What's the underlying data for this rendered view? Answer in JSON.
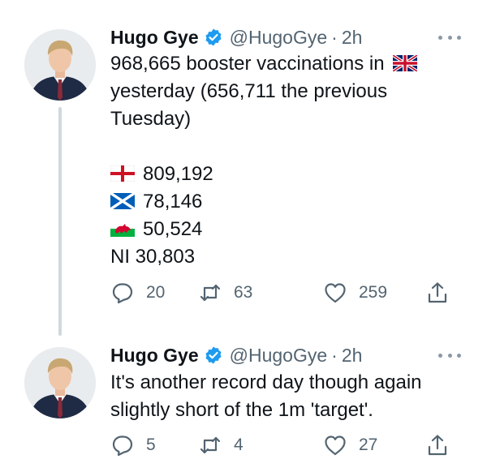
{
  "tweets": [
    {
      "author": {
        "name": "Hugo Gye",
        "handle": "@HugoGye",
        "separator": "·",
        "time": "2h"
      },
      "text": {
        "line1": "968,665 booster vaccinations in",
        "line1_flag": "uk-flag",
        "line2": "yesterday (656,711 the previous",
        "line3": "Tuesday)",
        "stats": [
          {
            "flag": "england-flag",
            "value": "809,192"
          },
          {
            "flag": "scotland-flag",
            "value": "78,146"
          },
          {
            "flag": "wales-flag",
            "value": "50,524"
          },
          {
            "flag": "",
            "value": "NI 30,803"
          }
        ]
      },
      "actions": {
        "replies": "20",
        "retweets": "63",
        "likes": "259"
      }
    },
    {
      "author": {
        "name": "Hugo Gye",
        "handle": "@HugoGye",
        "separator": "·",
        "time": "2h"
      },
      "text": {
        "line1": "It's another record day though again",
        "line2": "slightly short of the 1m 'target'."
      },
      "actions": {
        "replies": "5",
        "retweets": "4",
        "likes": "27"
      }
    }
  ],
  "colors": {
    "text": "#0f1419",
    "secondary": "#536471",
    "verified": "#1d9bf0",
    "thread_line": "#cfd9de"
  },
  "icons": [
    "verified-badge-icon",
    "more-icon",
    "reply-icon",
    "retweet-icon",
    "like-icon",
    "share-icon"
  ]
}
